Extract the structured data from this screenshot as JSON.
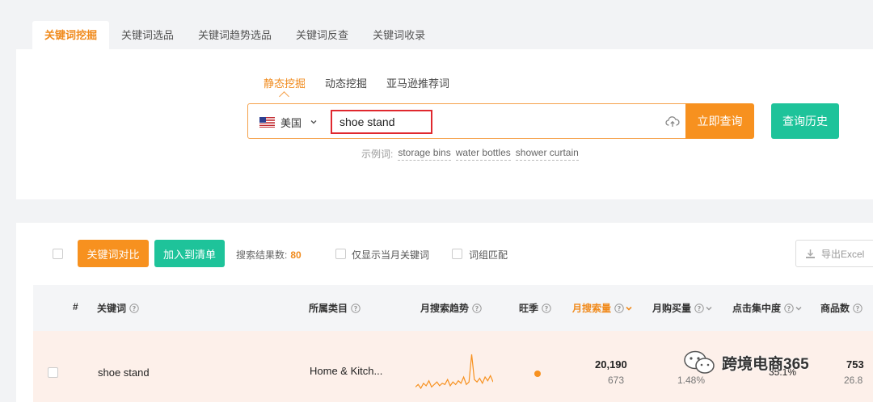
{
  "tabs": [
    {
      "label": "关键词挖掘",
      "active": true
    },
    {
      "label": "关键词选品",
      "active": false
    },
    {
      "label": "关键词趋势选品",
      "active": false
    },
    {
      "label": "关键词反查",
      "active": false
    },
    {
      "label": "关键词收录",
      "active": false
    }
  ],
  "search": {
    "subtabs": [
      {
        "label": "静态挖掘",
        "active": true
      },
      {
        "label": "动态挖掘",
        "active": false
      },
      {
        "label": "亚马逊推荐词",
        "active": false
      }
    ],
    "country": "美国",
    "keyword": "shoe stand",
    "query_button": "立即查询",
    "history_button": "查询历史",
    "examples_label": "示例词:",
    "examples": [
      "storage bins",
      "water bottles",
      "shower curtain"
    ]
  },
  "results": {
    "compare_button": "关键词对比",
    "add_button": "加入到清单",
    "count_label": "搜索结果数:",
    "count": "80",
    "option_current_month": "仅显示当月关键词",
    "option_phrase_match": "词组匹配",
    "export_button": "导出Excel",
    "columns": {
      "index": "#",
      "keyword": "关键词",
      "category": "所属类目",
      "trend": "月搜索趋势",
      "peak": "旺季",
      "monthly_search": "月搜索量",
      "monthly_purchase": "月购买量",
      "click_concentration": "点击集中度",
      "product_count": "商品数"
    },
    "rows": [
      {
        "keyword": "shoe stand",
        "category": "Home & Kitch...",
        "monthly_search": "20,190",
        "monthly_search_sub": "673",
        "monthly_purchase_sub": "1.48%",
        "click_concentration": "35.1%",
        "product_count": "753",
        "product_count_sub": "26.8",
        "trend": [
          4,
          6,
          3,
          7,
          5,
          9,
          4,
          6,
          8,
          5,
          7,
          6,
          10,
          5,
          8,
          6,
          9,
          7,
          12,
          6,
          8,
          30,
          10,
          8,
          11,
          7,
          12,
          9,
          13,
          8
        ]
      }
    ]
  },
  "watermark": "跨境电商365",
  "colors": {
    "accent": "#f7911f",
    "green": "#1ec39a",
    "highlight": "#e0282e"
  }
}
